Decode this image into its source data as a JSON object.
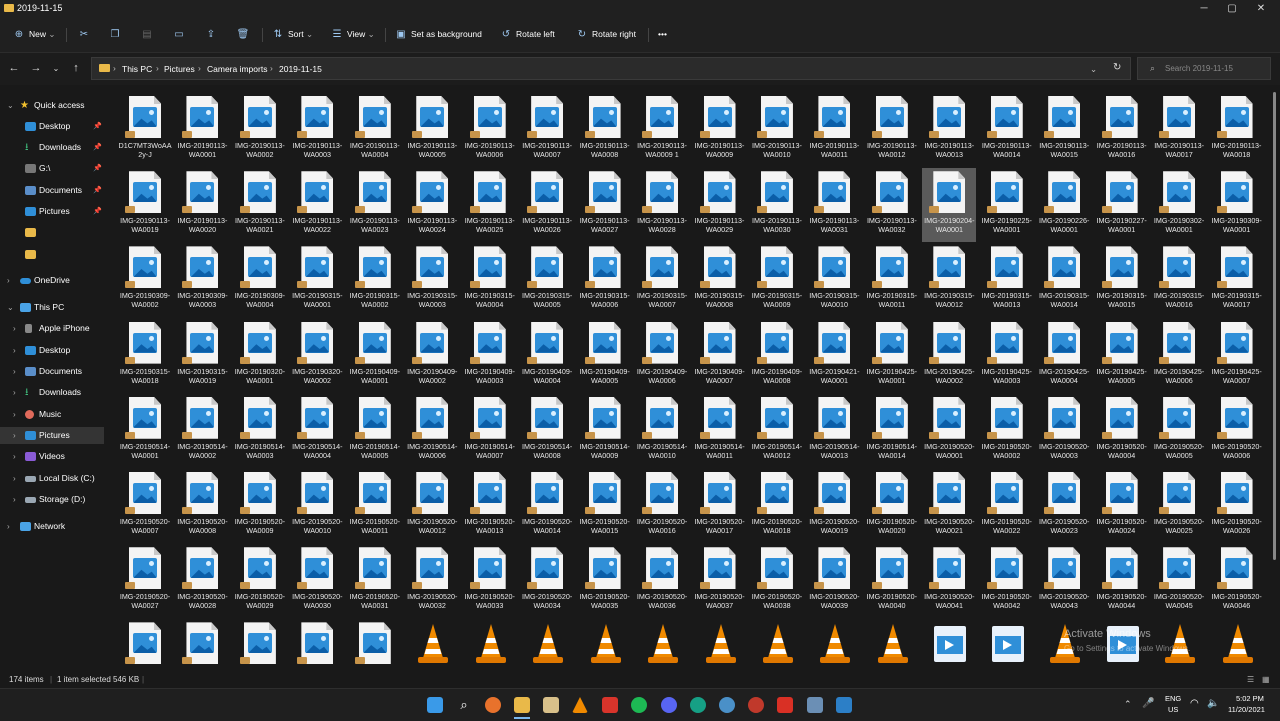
{
  "window": {
    "title": "2019-11-15"
  },
  "toolbar": {
    "new": "New",
    "sort": "Sort",
    "view": "View",
    "set_background": "Set as background",
    "rotate_left": "Rotate left",
    "rotate_right": "Rotate right",
    "more": "•••"
  },
  "address": {
    "crumbs": [
      "This PC",
      "Pictures",
      "Camera imports",
      "2019-11-15"
    ],
    "search_placeholder": "Search 2019-11-15"
  },
  "sidebar": {
    "items": [
      "Quick access",
      "Desktop",
      "Downloads",
      "G:\\",
      "Documents",
      "Pictures",
      "",
      "",
      "OneDrive",
      "This PC",
      "Apple iPhone",
      "Desktop",
      "Documents",
      "Downloads",
      "Music",
      "Pictures",
      "Videos",
      "Local Disk (C:)",
      "Storage (D:)",
      "Network"
    ]
  },
  "files": [
    "D1C7MT3WoAA2y-J",
    "IMG-20190113-WA0001",
    "IMG-20190113-WA0002",
    "IMG-20190113-WA0003",
    "IMG-20190113-WA0004",
    "IMG-20190113-WA0005",
    "IMG-20190113-WA0006",
    "IMG-20190113-WA0007",
    "IMG-20190113-WA0008",
    "IMG-20190113-WA0009 1",
    "IMG-20190113-WA0009",
    "IMG-20190113-WA0010",
    "IMG-20190113-WA0011",
    "IMG-20190113-WA0012",
    "IMG-20190113-WA0013",
    "IMG-20190113-WA0014",
    "IMG-20190113-WA0015",
    "IMG-20190113-WA0016",
    "IMG-20190113-WA0017",
    "IMG-20190113-WA0018",
    "IMG-20190113-WA0019",
    "IMG-20190113-WA0020",
    "IMG-20190113-WA0021",
    "IMG-20190113-WA0022",
    "IMG-20190113-WA0023",
    "IMG-20190113-WA0024",
    "IMG-20190113-WA0025",
    "IMG-20190113-WA0026",
    "IMG-20190113-WA0027",
    "IMG-20190113-WA0028",
    "IMG-20190113-WA0029",
    "IMG-20190113-WA0030",
    "IMG-20190113-WA0031",
    "IMG-20190113-WA0032",
    "IMG-20190204-WA0001",
    "IMG-20190225-WA0001",
    "IMG-20190226-WA0001",
    "IMG-20190227-WA0001",
    "IMG-20190302-WA0001",
    "IMG-20190309-WA0001",
    "IMG-20190309-WA0002",
    "IMG-20190309-WA0003",
    "IMG-20190309-WA0004",
    "IMG-20190315-WA0001",
    "IMG-20190315-WA0002",
    "IMG-20190315-WA0003",
    "IMG-20190315-WA0004",
    "IMG-20190315-WA0005",
    "IMG-20190315-WA0006",
    "IMG-20190315-WA0007",
    "IMG-20190315-WA0008",
    "IMG-20190315-WA0009",
    "IMG-20190315-WA0010",
    "IMG-20190315-WA0011",
    "IMG-20190315-WA0012",
    "IMG-20190315-WA0013",
    "IMG-20190315-WA0014",
    "IMG-20190315-WA0015",
    "IMG-20190315-WA0016",
    "IMG-20190315-WA0017",
    "IMG-20190315-WA0018",
    "IMG-20190315-WA0019",
    "IMG-20190320-WA0001",
    "IMG-20190320-WA0002",
    "IMG-20190409-WA0001",
    "IMG-20190409-WA0002",
    "IMG-20190409-WA0003",
    "IMG-20190409-WA0004",
    "IMG-20190409-WA0005",
    "IMG-20190409-WA0006",
    "IMG-20190409-WA0007",
    "IMG-20190409-WA0008",
    "IMG-20190421-WA0001",
    "IMG-20190425-WA0001",
    "IMG-20190425-WA0002",
    "IMG-20190425-WA0003",
    "IMG-20190425-WA0004",
    "IMG-20190425-WA0005",
    "IMG-20190425-WA0006",
    "IMG-20190425-WA0007",
    "IMG-20190514-WA0001",
    "IMG-20190514-WA0002",
    "IMG-20190514-WA0003",
    "IMG-20190514-WA0004",
    "IMG-20190514-WA0005",
    "IMG-20190514-WA0006",
    "IMG-20190514-WA0007",
    "IMG-20190514-WA0008",
    "IMG-20190514-WA0009",
    "IMG-20190514-WA0010",
    "IMG-20190514-WA0011",
    "IMG-20190514-WA0012",
    "IMG-20190514-WA0013",
    "IMG-20190514-WA0014",
    "IMG-20190520-WA0001",
    "IMG-20190520-WA0002",
    "IMG-20190520-WA0003",
    "IMG-20190520-WA0004",
    "IMG-20190520-WA0005",
    "IMG-20190520-WA0006",
    "IMG-20190520-WA0007",
    "IMG-20190520-WA0008",
    "IMG-20190520-WA0009",
    "IMG-20190520-WA0010",
    "IMG-20190520-WA0011",
    "IMG-20190520-WA0012",
    "IMG-20190520-WA0013",
    "IMG-20190520-WA0014",
    "IMG-20190520-WA0015",
    "IMG-20190520-WA0016",
    "IMG-20190520-WA0017",
    "IMG-20190520-WA0018",
    "IMG-20190520-WA0019",
    "IMG-20190520-WA0020",
    "IMG-20190520-WA0021",
    "IMG-20190520-WA0022",
    "IMG-20190520-WA0023",
    "IMG-20190520-WA0024",
    "IMG-20190520-WA0025",
    "IMG-20190520-WA0026",
    "IMG-20190520-WA0027",
    "IMG-20190520-WA0028",
    "IMG-20190520-WA0029",
    "IMG-20190520-WA0030",
    "IMG-20190520-WA0031",
    "IMG-20190520-WA0032",
    "IMG-20190520-WA0033",
    "IMG-20190520-WA0034",
    "IMG-20190520-WA0035",
    "IMG-20190520-WA0036",
    "IMG-20190520-WA0037",
    "IMG-20190520-WA0038",
    "IMG-20190520-WA0039",
    "IMG-20190520-WA0040",
    "IMG-20190520-WA0041",
    "IMG-20190520-WA0042",
    "IMG-20190520-WA0043",
    "IMG-20190520-WA0044",
    "IMG-20190520-WA0045",
    "IMG-20190520-WA0046"
  ],
  "last_row_types": [
    "image",
    "image",
    "image",
    "image",
    "image",
    "vlc",
    "vlc",
    "vlc",
    "vlc",
    "vlc",
    "vlc",
    "vlc",
    "vlc",
    "vlc",
    "video",
    "video",
    "vlc",
    "video",
    "vlc",
    "vlc"
  ],
  "selected_file": "IMG-20190204-WA0001",
  "status": {
    "count": "174 items",
    "selection": "1 item selected",
    "size": "546 KB"
  },
  "watermark": {
    "line1": "Activate Windows",
    "line2": "Go to Settings to activate Windows."
  },
  "tray": {
    "lang": "ENG",
    "region": "US",
    "time": "5:02 PM",
    "date": "11/20/2021"
  },
  "colors": {
    "accent": "#2f8fd8",
    "folder": "#e9b949",
    "vlc": "#f08a00"
  }
}
